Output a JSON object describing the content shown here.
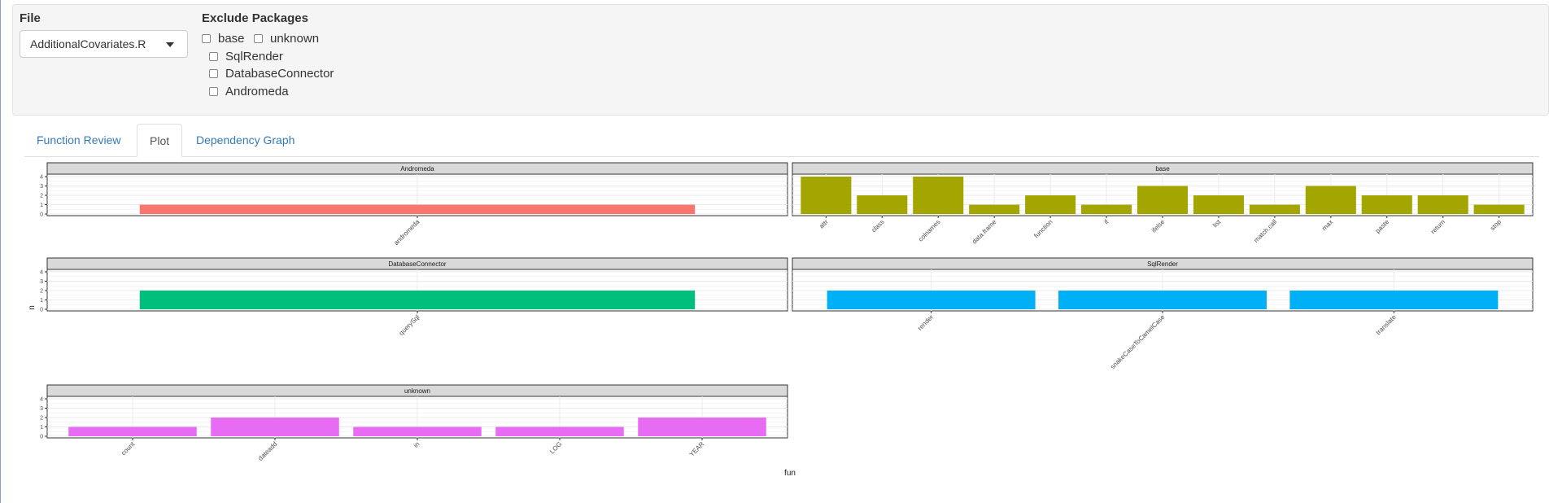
{
  "controls": {
    "file_label": "File",
    "file_value": "AdditionalCovariates.R",
    "exclude_label": "Exclude Packages",
    "packages": [
      "base",
      "unknown",
      "SqlRender",
      "DatabaseConnector",
      "Andromeda"
    ]
  },
  "tabs": [
    "Function Review",
    "Plot",
    "Dependency Graph"
  ],
  "active_tab": "Plot",
  "chart_data": {
    "type": "bar",
    "facet_by": "package",
    "xlabel": "fun",
    "ylabel": "n",
    "ylim": [
      0,
      4
    ],
    "y_ticks": [
      0,
      1,
      2,
      3,
      4
    ],
    "grid": true,
    "facets": [
      {
        "name": "Andromeda",
        "color": "#F8766D",
        "categories": [
          "andromeda"
        ],
        "values": [
          1
        ]
      },
      {
        "name": "base",
        "color": "#A3A500",
        "categories": [
          "attr",
          "class",
          "colnames",
          "data.frame",
          "function",
          "if",
          "ifelse",
          "list",
          "match.call",
          "max",
          "paste",
          "return",
          "stop"
        ],
        "values": [
          4,
          2,
          4,
          1,
          2,
          1,
          3,
          2,
          1,
          3,
          2,
          2,
          1
        ]
      },
      {
        "name": "DatabaseConnector",
        "color": "#00BF7D",
        "categories": [
          "querySql"
        ],
        "values": [
          2
        ]
      },
      {
        "name": "SqlRender",
        "color": "#00B0F6",
        "categories": [
          "render",
          "snakeCaseToCamelCase",
          "translate"
        ],
        "values": [
          2,
          2,
          2
        ]
      },
      {
        "name": "unknown",
        "color": "#E76BF3",
        "categories": [
          "count",
          "dateadd",
          "in",
          "LOG",
          "YEAR"
        ],
        "values": [
          1,
          2,
          1,
          1,
          2
        ]
      }
    ]
  }
}
